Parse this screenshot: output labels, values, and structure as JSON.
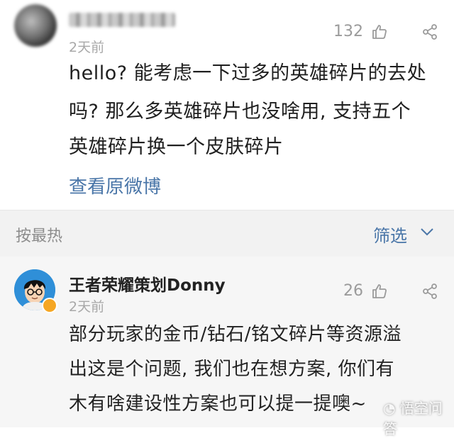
{
  "comment": {
    "time": "2天前",
    "like_count": "132",
    "lines": [
      "hello? 能考虑一下过多的英雄碎片的去处",
      "吗? 那么多英雄碎片也没啥用, 支持五个",
      "英雄碎片换一个皮肤碎片"
    ],
    "view_original": "查看原微博"
  },
  "sort_bar": {
    "sort_label": "按最热",
    "filter_label": "筛选"
  },
  "reply": {
    "author": "王者荣耀策划Donny",
    "time": "2天前",
    "like_count": "26",
    "lines": [
      "部分玩家的金币/钻石/铭文碎片等资源溢",
      "出这是个问题, 我们也在想方案, 你们有",
      "木有啥建设性方案也可以提一提噢~"
    ]
  },
  "watermark": "悟空问答",
  "colors": {
    "link": "#4a76a8",
    "muted": "#a8a8a8",
    "sort_bar_bg": "#f2f2f2"
  }
}
